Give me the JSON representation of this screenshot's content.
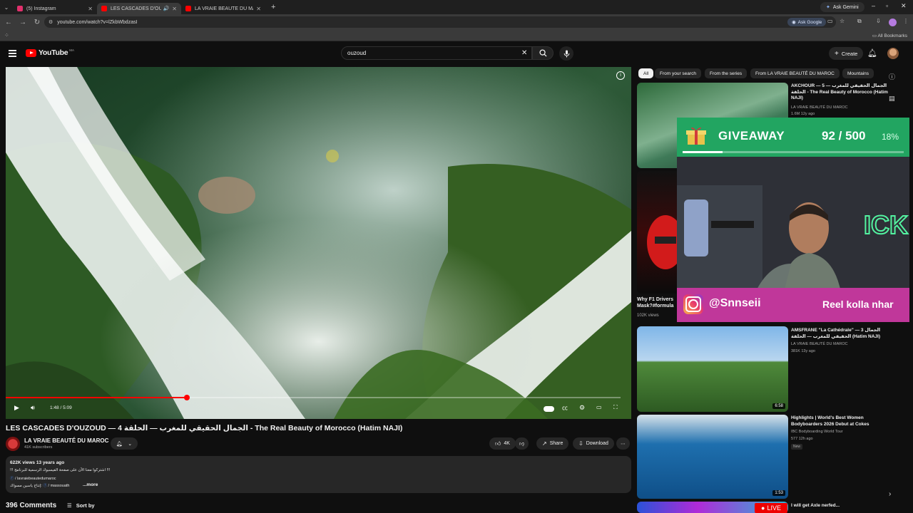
{
  "browser": {
    "tabs": [
      {
        "title": "(5) Instagram",
        "fav_color": "#e1306c",
        "active": false
      },
      {
        "title": "LES CASCADES D'OUZOUD",
        "fav_color": "#ff0000",
        "active": true
      },
      {
        "title": "LA VRAIE BEAUTÉ DU MAROC",
        "fav_color": "#ff0000",
        "active": false
      }
    ],
    "ask_gemini": "Ask Gemini",
    "url": "youtube.com/watch?v=lZkbWbdzasI",
    "ask_google": "Ask Google",
    "all_bookmarks": "All Bookmarks"
  },
  "masthead": {
    "logo_text": "YouTube",
    "region": "MA",
    "search_value": "ouzoud",
    "create_label": "Create"
  },
  "player": {
    "current_time": "1:48 / 5:09",
    "progress": 0.295
  },
  "video": {
    "title": "LES CASCADES D'OUZOUD — 4 الجمال الحقيقي للمغرب — الحلقة - The Real Beauty of Morocco (Hatim NAJI)",
    "channel": "LA VRAIE BEAUTÉ DU MAROC",
    "subscribers": "41K subscribers",
    "likes": "4K",
    "share_label": "Share",
    "download_label": "Download",
    "stats": "622K views  13 years ago",
    "desc_line1": "!!! اشتركوا معنا الآن على صفحة الفيسبوك الرسمية للبرنامج !!!",
    "desc_line2": "/ lavraiebeautedumaroc",
    "desc_line3": "إنتاج ياسين مسواك:",
    "desc_line3b": "/ massouath",
    "more_label": "...more",
    "comments": "396 Comments",
    "sort_label": "Sort by"
  },
  "chips": [
    "All",
    "From your search",
    "From the series",
    "From LA VRAIE BEAUTÉ DU MAROC",
    "Mountains"
  ],
  "related": [
    {
      "title": "AKCHOUR — 5 الجمال الحقيقي للمغرب — الحلقة - The Real Beauty of Morocco (Hatim NAJI)",
      "channel": "LA VRAIE BEAUTÉ DU MAROC",
      "meta": "1.6M  12y ago"
    },
    {
      "title": "Why F1 Drivers Mask?#formula",
      "meta": "102K views"
    },
    {
      "title": "AMSFRANE \"La Cathédrale\" — الجمال 3 الحقيقي للمغرب — الحلقة (Hatim NAJI)",
      "channel": "LA VRAIE BEAUTÉ DU MAROC",
      "meta": "381K  13y ago",
      "duration": "6:58"
    },
    {
      "title": "Highlights | World's Best Women Bodyboarders 2026 Debut at Cokes",
      "channel": "IBC Bodyboarding World Tour",
      "meta": "577  12h ago",
      "badge": "New",
      "duration": "1:53"
    },
    {
      "title": "I will get Axle nerfed...",
      "live": "LIVE"
    }
  ],
  "overlay": {
    "giveaway_label": "GIVEAWAY",
    "count": "92 / 500",
    "percent": "18%",
    "progress": 0.18,
    "handle": "@Snnseii",
    "note": "Reel kolla nhar"
  },
  "colors": {
    "yt_red": "#ff0000",
    "giveaway_green": "#22a561",
    "instagram_pink": "#c0379a"
  }
}
